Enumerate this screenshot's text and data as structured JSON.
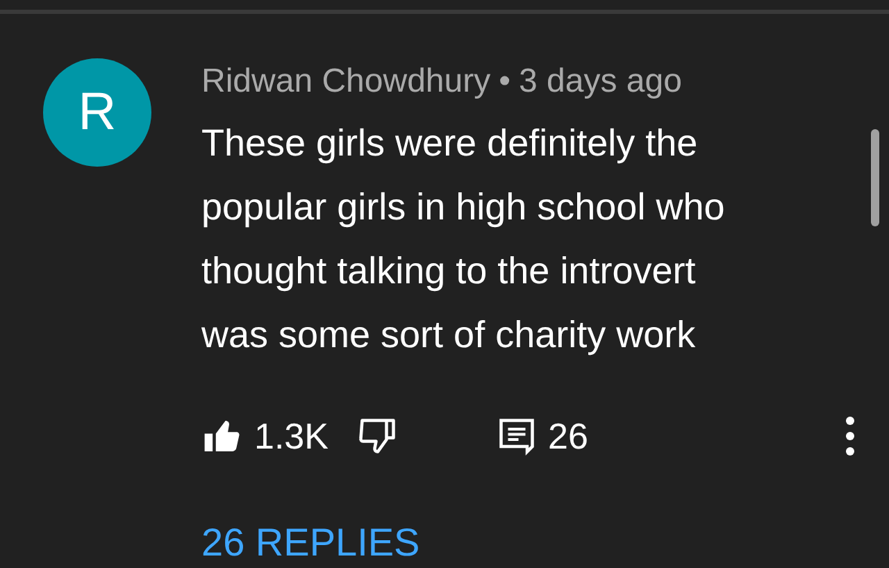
{
  "comment": {
    "avatar": {
      "letter": "R",
      "color": "#0097a7"
    },
    "author": "Ridwan Chowdhury",
    "separator": "•",
    "time": "3 days ago",
    "text": "These girls were definitely the\npopular girls in high school who\nthought talking to the introvert\nwas some sort of charity work",
    "likes": "1.3K",
    "liked": true,
    "disliked": false,
    "reply_count": "26",
    "replies_link": "26 REPLIES"
  }
}
